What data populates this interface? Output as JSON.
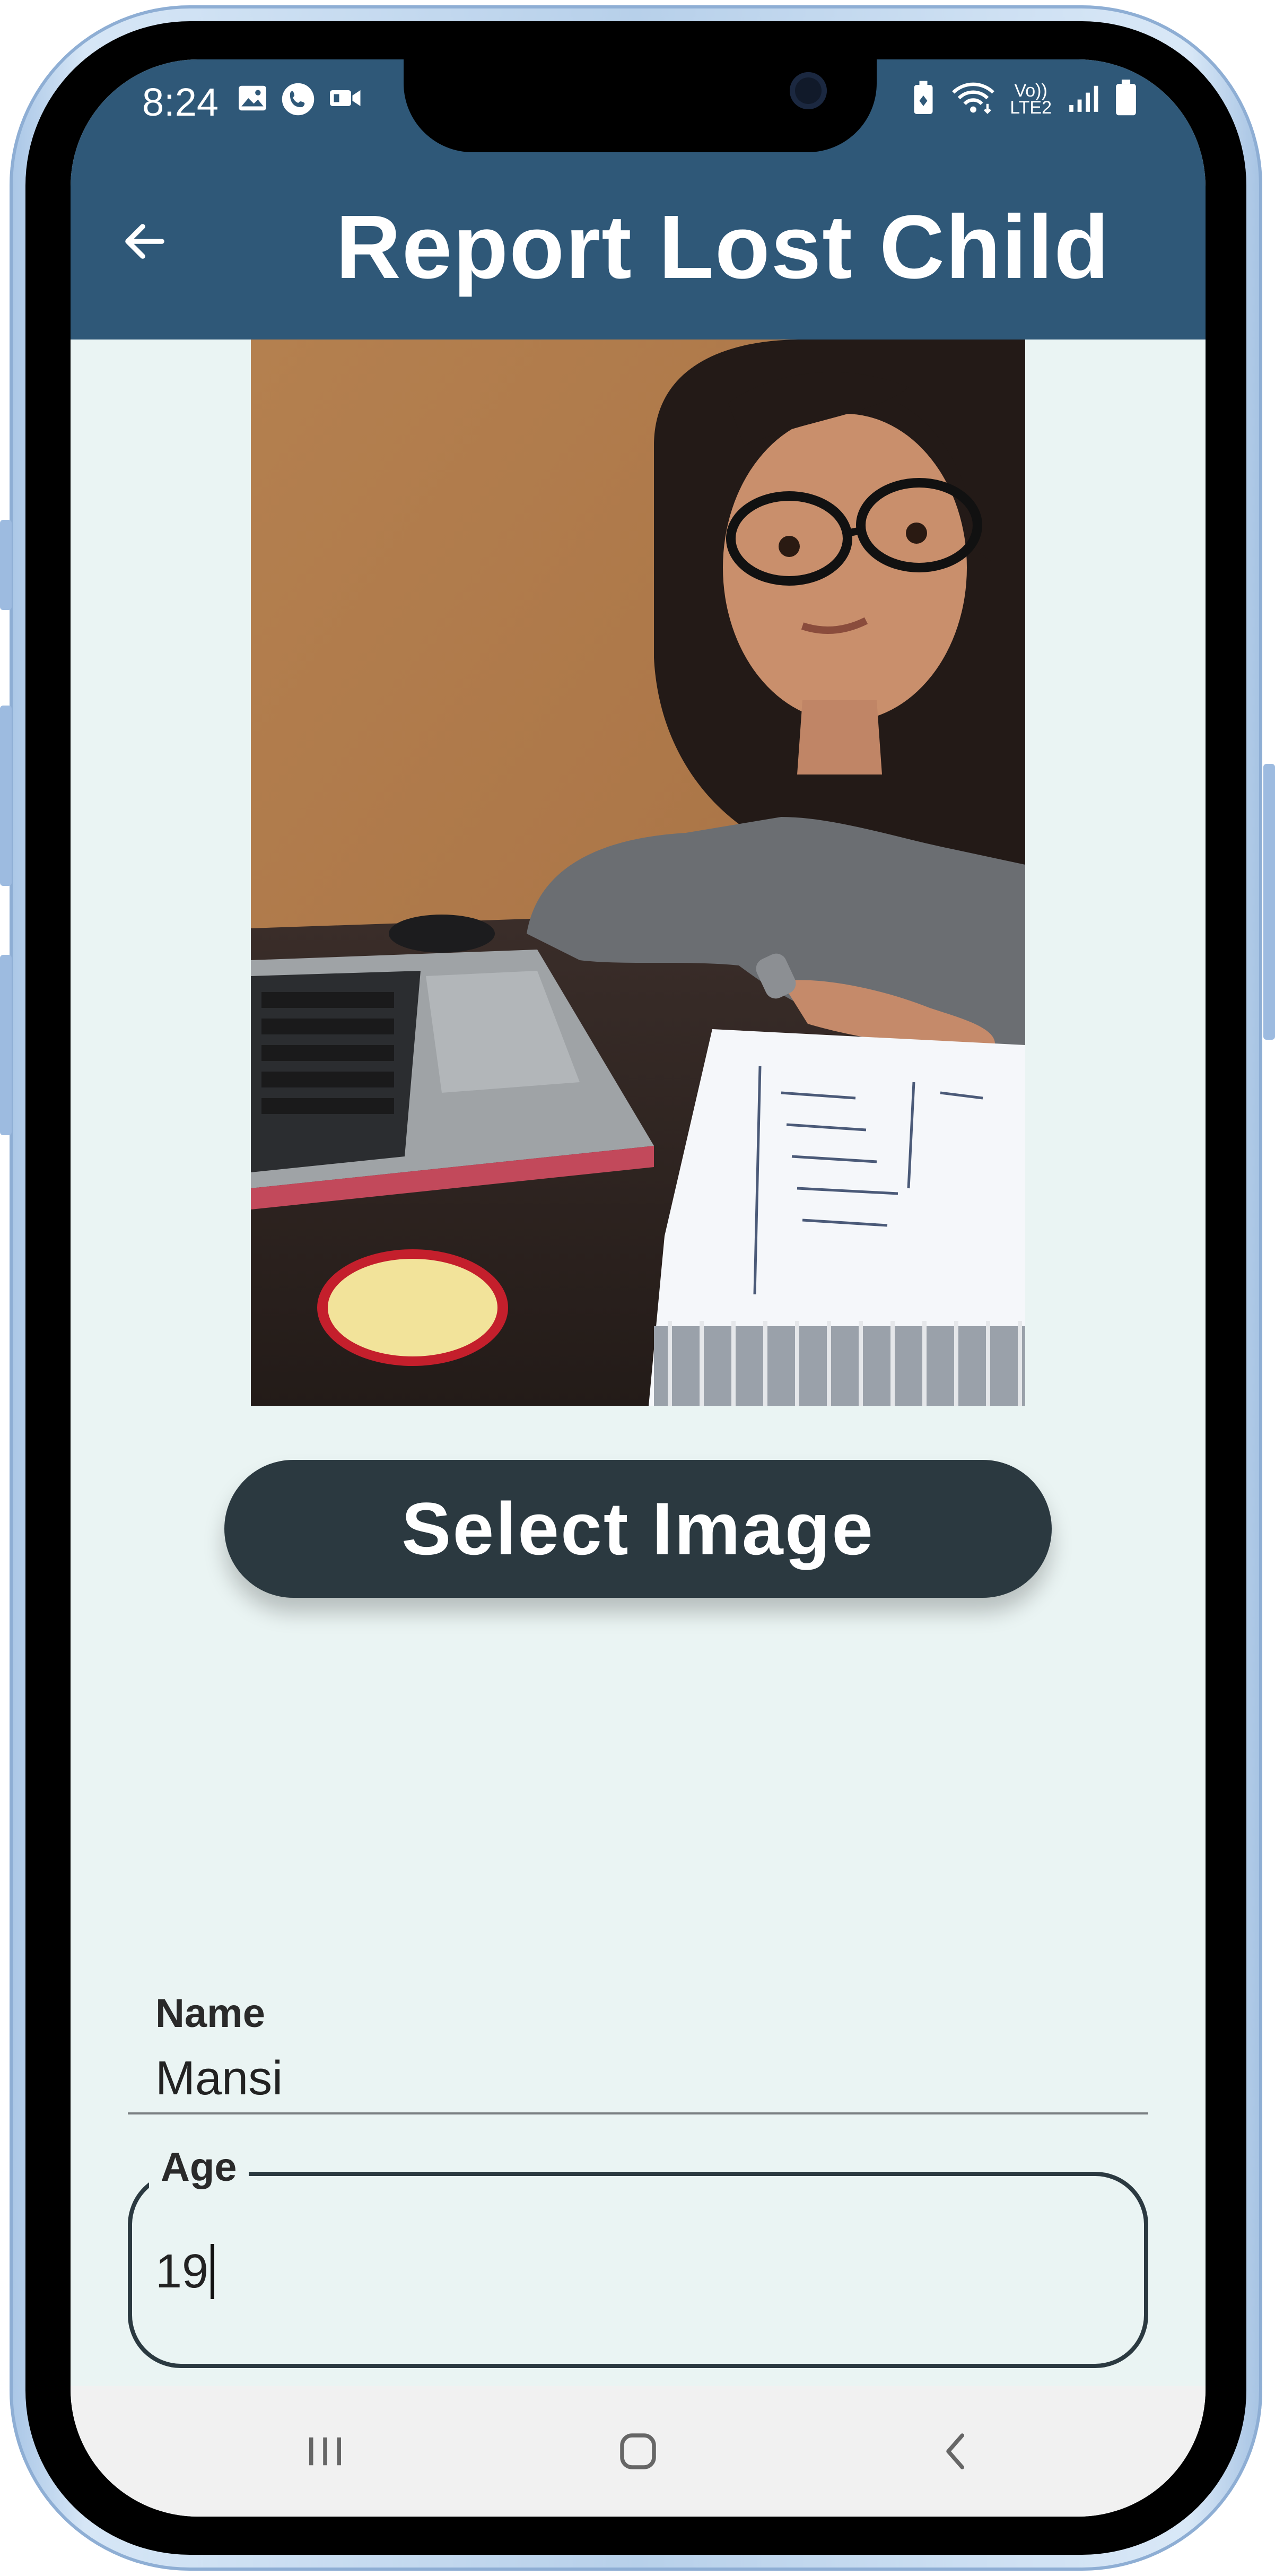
{
  "status_bar": {
    "time": "8:24",
    "left_icons": [
      "gallery-icon",
      "phone-call-icon",
      "video-icon"
    ],
    "right_icons": [
      "battery-saver-icon",
      "wifi-icon",
      "volte-icon",
      "signal-icon",
      "battery-icon"
    ],
    "volte_line1": "Vo))",
    "volte_line2": "LTE2"
  },
  "app_bar": {
    "title": "Report Lost Child",
    "back_icon": "arrow-left-icon",
    "background_color": "#2f5878"
  },
  "photo": {
    "subject": "photo-preview"
  },
  "select_image_button": {
    "label": "Select Image",
    "color": "#2b3940"
  },
  "form": {
    "name": {
      "label": "Name",
      "value": "Mansi"
    },
    "age": {
      "label": "Age",
      "value": "19"
    }
  },
  "nav_bar": {
    "icons": [
      "recents-icon",
      "home-icon",
      "back-icon"
    ]
  },
  "colors": {
    "screen_background": "#eaf4f3",
    "accent": "#2f5878",
    "button": "#2b3940"
  }
}
